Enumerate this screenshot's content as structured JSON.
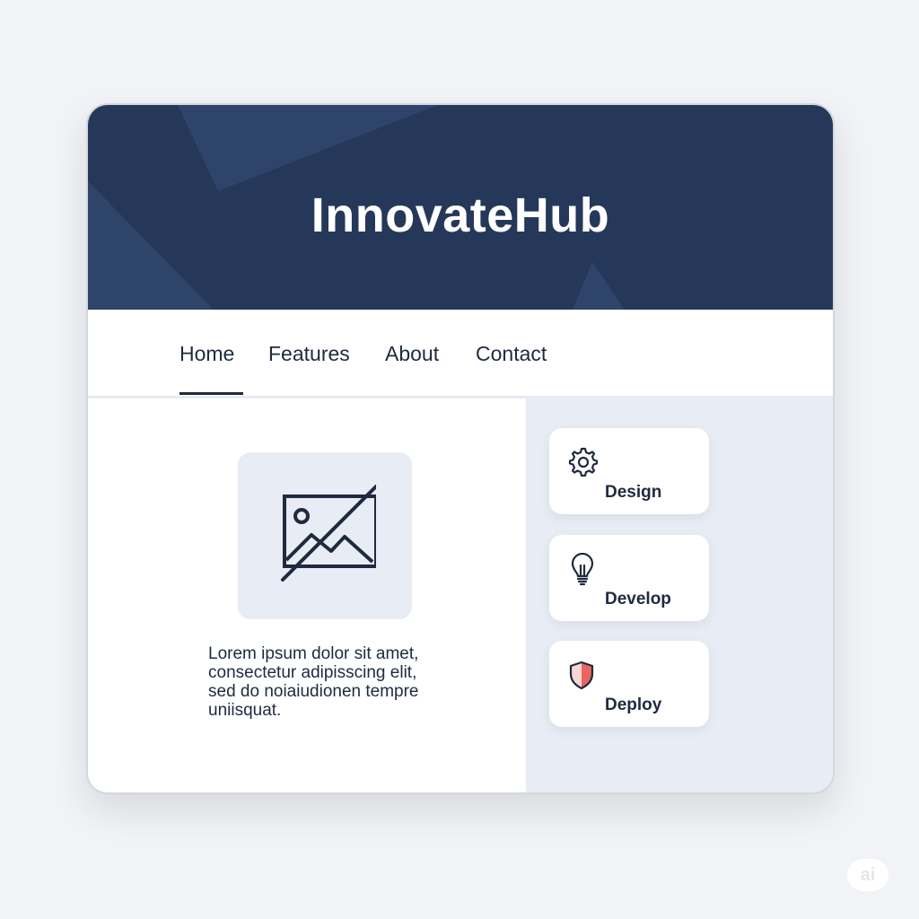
{
  "site": {
    "title": "InnovateHub"
  },
  "nav": {
    "items": [
      {
        "label": "Home",
        "active": true
      },
      {
        "label": "Features",
        "active": false
      },
      {
        "label": "About",
        "active": false
      },
      {
        "label": "Contact",
        "active": false
      }
    ]
  },
  "main": {
    "image_icon": "image-placeholder-icon",
    "text": "Lorem ipsum dolor sit amet, consectetur adipisscing elit, sed do noiaiudionen tempre uniisquat.",
    "text_lines": [
      "Lorem ipsum dolor sit amet,",
      "consectetur adipisscing elit,",
      "sed do noiaiudionen tempre",
      "uniisquat."
    ]
  },
  "cards": [
    {
      "label": "Design",
      "icon": "gear-icon"
    },
    {
      "label": "Develop",
      "icon": "lightbulb-icon"
    },
    {
      "label": "Deploy",
      "icon": "shield-icon"
    }
  ],
  "badge": {
    "label": "ai"
  },
  "colors": {
    "hero": "#263859",
    "text": "#1f2a3f",
    "panel": "#e8ecf4",
    "shield_accent": "#e8665f"
  }
}
